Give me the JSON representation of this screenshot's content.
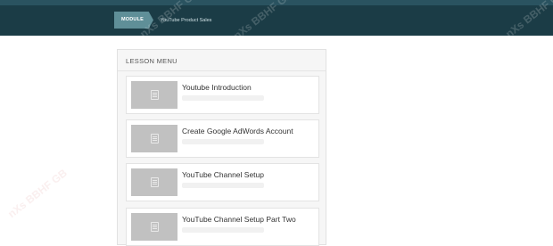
{
  "breadcrumb": {
    "module_label": "MODULE",
    "current": "YouTube Product Sales"
  },
  "lesson_menu": {
    "title": "LESSON MENU",
    "items": [
      {
        "title": "Youtube Introduction",
        "icon": "document-icon"
      },
      {
        "title": "Create Google AdWords Account",
        "icon": "document-icon"
      },
      {
        "title": "YouTube Channel Setup",
        "icon": "document-icon"
      },
      {
        "title": "YouTube Channel Setup Part Two",
        "icon": "document-icon"
      }
    ]
  },
  "watermark": {
    "text": "nXs BBHF GB"
  },
  "colors": {
    "header": "#1b3c46",
    "breadcrumb_accent": "#5f8f98",
    "panel_bg": "#f6f6f6"
  }
}
